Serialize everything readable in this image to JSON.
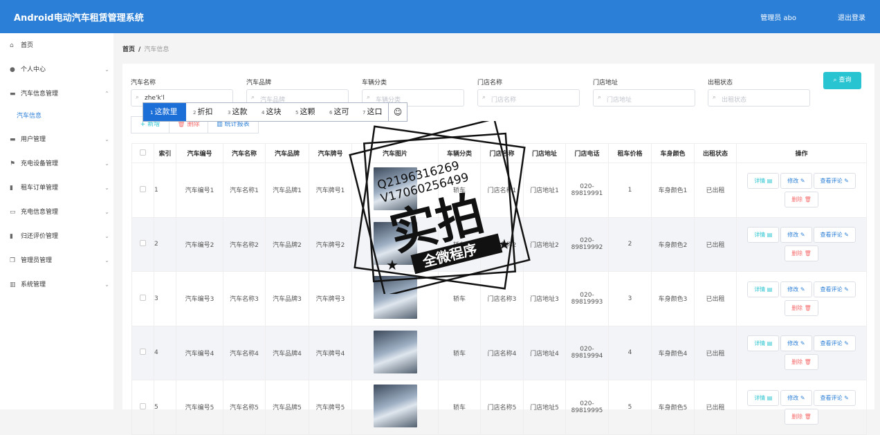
{
  "header": {
    "title": "Android电动汽车租赁管理系统",
    "admin": "管理员 abo",
    "logout": "退出登录"
  },
  "sidebar": {
    "items": [
      {
        "label": "首页",
        "icon": "home-icon",
        "chevron": ""
      },
      {
        "label": "个人中心",
        "icon": "user-icon",
        "chevron": "⌄"
      },
      {
        "label": "汽车信息管理",
        "icon": "car-info-icon",
        "chevron": "⌃"
      },
      {
        "label": "汽车信息",
        "icon": "",
        "chevron": ""
      },
      {
        "label": "用户管理",
        "icon": "users-icon",
        "chevron": "⌄"
      },
      {
        "label": "充电设备管理",
        "icon": "flag-icon",
        "chevron": "⌄"
      },
      {
        "label": "租车订单管理",
        "icon": "order-icon",
        "chevron": "⌄"
      },
      {
        "label": "充电信息管理",
        "icon": "charge-icon",
        "chevron": "⌄"
      },
      {
        "label": "归还评价管理",
        "icon": "review-icon",
        "chevron": "⌄"
      },
      {
        "label": "管理员管理",
        "icon": "admin-icon",
        "chevron": "⌄"
      },
      {
        "label": "系统管理",
        "icon": "system-icon",
        "chevron": "⌄"
      }
    ]
  },
  "breadcrumb": {
    "home": "首页",
    "sep": "/",
    "current": "汽车信息"
  },
  "filters": [
    {
      "label": "汽车名称",
      "placeholder": "汽车名称",
      "value": "zhe'k'l"
    },
    {
      "label": "汽车品牌",
      "placeholder": "汽车品牌",
      "value": ""
    },
    {
      "label": "车辆分类",
      "placeholder": "车辆分类",
      "value": ""
    },
    {
      "label": "门店名称",
      "placeholder": "门店名称",
      "value": ""
    },
    {
      "label": "门店地址",
      "placeholder": "门店地址",
      "value": ""
    },
    {
      "label": "出租状态",
      "placeholder": "出租状态",
      "value": ""
    }
  ],
  "query_label": "查询",
  "toolbar": {
    "add": "+ 新增",
    "delete": "删除",
    "stats": "统计报表"
  },
  "ime": {
    "candidates": [
      {
        "num": "1",
        "text": "这款里"
      },
      {
        "num": "2",
        "text": "折扣"
      },
      {
        "num": "3",
        "text": "这款"
      },
      {
        "num": "4",
        "text": "这块"
      },
      {
        "num": "5",
        "text": "这颗"
      },
      {
        "num": "6",
        "text": "这可"
      },
      {
        "num": "7",
        "text": "这口"
      }
    ],
    "emoji": "☺"
  },
  "table": {
    "headers": [
      "",
      "索引",
      "汽车编号",
      "汽车名称",
      "汽车品牌",
      "汽车牌号",
      "汽车图片",
      "车辆分类",
      "门店名称",
      "门店地址",
      "门店电话",
      "租车价格",
      "车身颜色",
      "出租状态",
      "操作"
    ],
    "rows": [
      {
        "idx": "1",
        "no": "汽车编号1",
        "name": "汽车名称1",
        "brand": "汽车品牌1",
        "plate": "汽车牌号1",
        "cat": "轿车",
        "store": "门店名称1",
        "addr": "门店地址1",
        "phone": "020-89819991",
        "price": "1",
        "color": "车身颜色1",
        "status": "已出租"
      },
      {
        "idx": "2",
        "no": "汽车编号2",
        "name": "汽车名称2",
        "brand": "汽车品牌2",
        "plate": "汽车牌号2",
        "cat": "轿车",
        "store": "门店名称2",
        "addr": "门店地址2",
        "phone": "020-89819992",
        "price": "2",
        "color": "车身颜色2",
        "status": "已出租"
      },
      {
        "idx": "3",
        "no": "汽车编号3",
        "name": "汽车名称3",
        "brand": "汽车品牌3",
        "plate": "汽车牌号3",
        "cat": "轿车",
        "store": "门店名称3",
        "addr": "门店地址3",
        "phone": "020-89819993",
        "price": "3",
        "color": "车身颜色3",
        "status": "已出租"
      },
      {
        "idx": "4",
        "no": "汽车编号4",
        "name": "汽车名称4",
        "brand": "汽车品牌4",
        "plate": "汽车牌号4",
        "cat": "轿车",
        "store": "门店名称4",
        "addr": "门店地址4",
        "phone": "020-89819994",
        "price": "4",
        "color": "车身颜色4",
        "status": "已出租"
      },
      {
        "idx": "5",
        "no": "汽车编号5",
        "name": "汽车名称5",
        "brand": "汽车品牌5",
        "plate": "汽车牌号5",
        "cat": "轿车",
        "store": "门店名称5",
        "addr": "门店地址5",
        "phone": "020-89819995",
        "price": "5",
        "color": "车身颜色5",
        "status": "已出租"
      }
    ],
    "actions": {
      "detail": "详情 ▤",
      "edit": "修改 ✎",
      "review": "查看评论 ✎",
      "delete": "删除 🗑"
    }
  },
  "watermark": {
    "line1": "Q2196316269",
    "line2": "V17060256499",
    "main": "实拍",
    "banner": "全微程序"
  },
  "colors": {
    "header": "#2b7fd6",
    "accent": "#29c4d1",
    "danger": "#f56c6c"
  }
}
